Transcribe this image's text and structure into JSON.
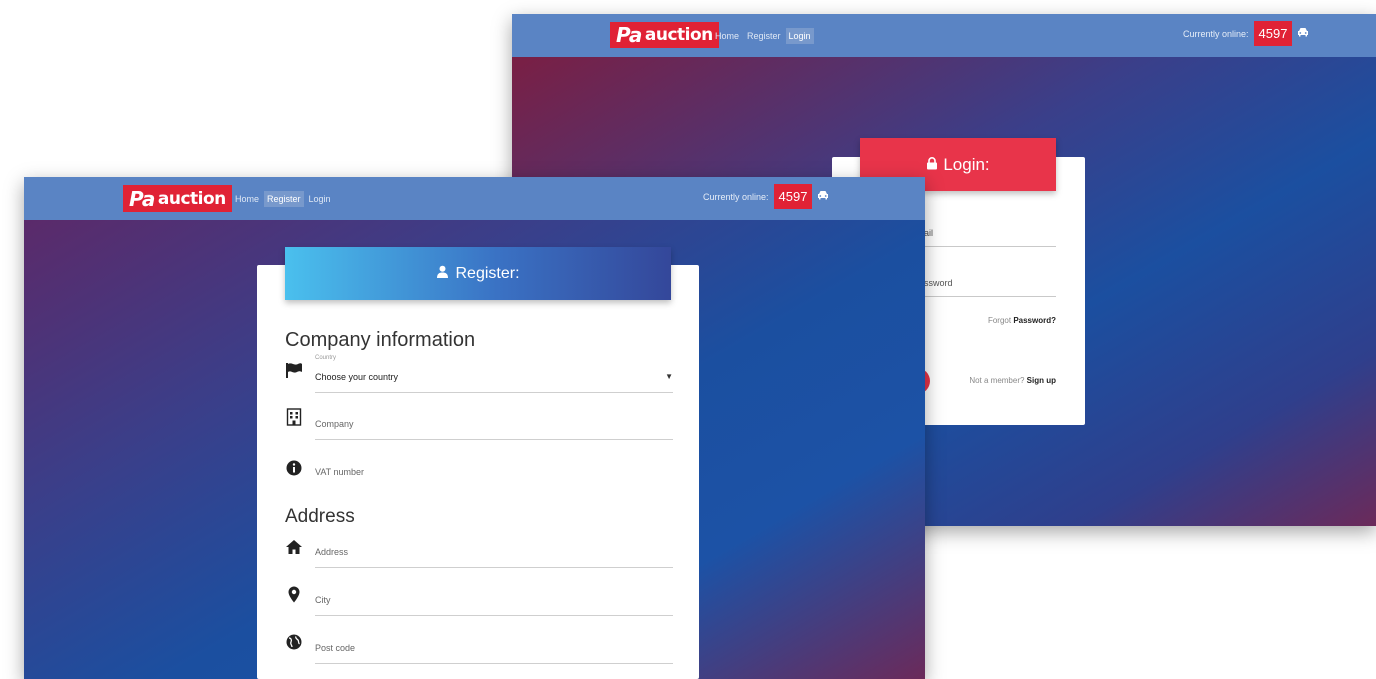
{
  "login_window": {
    "logo": {
      "pa": "Pa",
      "auction": "auction"
    },
    "nav": [
      "Home",
      "Register",
      "Login"
    ],
    "nav_active": "Login",
    "online_label": "Currently online:",
    "online_count": "4597",
    "header": "Login:",
    "email_partial": "ail",
    "password_partial": "ssword",
    "forgot_prefix": "Forgot ",
    "forgot_bold": "Password?",
    "signup_prefix": "Not a member? ",
    "signup_bold": "Sign up"
  },
  "register_window": {
    "logo": {
      "pa": "Pa",
      "auction": "auction"
    },
    "nav": [
      "Home",
      "Register",
      "Login"
    ],
    "nav_active": "Register",
    "online_label": "Currently online:",
    "online_count": "4597",
    "header": "Register:",
    "company_section": "Company information",
    "country_label": "Country",
    "country_value": "Choose your country",
    "company_placeholder": "Company",
    "vat_placeholder": "VAT number",
    "address_section": "Address",
    "address_placeholder": "Address",
    "city_placeholder": "City",
    "postcode_placeholder": "Post code"
  },
  "colors": {
    "topbar": "#5a84c4",
    "accent_red": "#e8344a",
    "register_gradient_start": "#4ac0ee",
    "register_gradient_end": "#34479a"
  }
}
